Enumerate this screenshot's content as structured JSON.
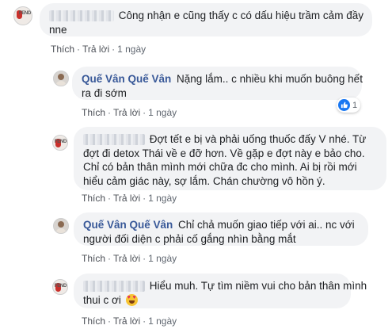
{
  "actions": {
    "like": "Thích",
    "reply": "Trả lời",
    "separator": "·"
  },
  "comments": [
    {
      "author": "",
      "author_redacted": true,
      "text_lines": [
        "Công nhận e cũng thấy c có dấu hiệu trầm cảm đầy",
        "nne"
      ],
      "time": "1 ngày",
      "avatar": "fend-logo-avatar"
    },
    {
      "author": "Quế Vân Quế Vân",
      "author_redacted": false,
      "text_lines": [
        "Nặng lắm.. c nhiều khi muốn buông hết",
        "ra đi sớm"
      ],
      "time": "1 ngày",
      "avatar": "profile-avatar",
      "reaction_count": "1"
    },
    {
      "author": "",
      "author_redacted": true,
      "text_lines": [
        "Đợt tết e bị và phải uống thuốc đấy V nhé. Từ",
        "đợt đi detox Thái về e đỡ hơn. Về gặp e đợt này e bảo cho.",
        "Chỉ có bản thân mình mới chữa đc cho mình. Ai bị rồi mới",
        "hiểu cảm giác này, sợ lắm. Chán chường vô hồn ý."
      ],
      "time": "1 ngày",
      "avatar": "fend-logo-avatar"
    },
    {
      "author": "Quế Vân Quế Vân",
      "author_redacted": false,
      "text_lines": [
        "Chỉ chả muốn giao tiếp với ai.. nc với",
        "người đối diện c phải cố gắng nhìn bằng mắt"
      ],
      "time": "1 ngày",
      "avatar": "profile-avatar"
    },
    {
      "author": "",
      "author_redacted": true,
      "text_lines": [
        "Hiểu muh. Tự tìm niềm vui cho bản thân mình",
        "thui c ơi"
      ],
      "emoji": "heart-eyes-emoji",
      "time": "1 ngày",
      "avatar": "fend-logo-avatar"
    }
  ],
  "colors": {
    "bubble": "#f2f3f5",
    "name": "#385898",
    "meta": "#606770",
    "like_icon": "#1877f2"
  }
}
